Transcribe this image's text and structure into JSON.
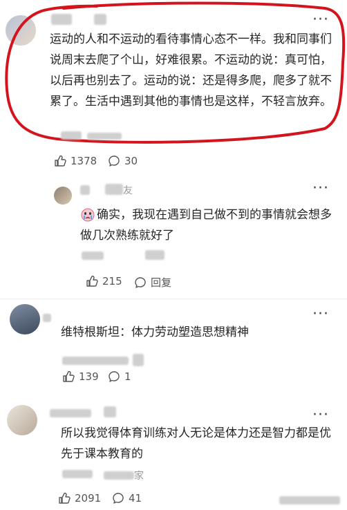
{
  "comments": [
    {
      "text": "运动的人和不运动的看待事情心态不一样。我和同事们说周末去爬了个山，好难很累。不运动的说：真可怕，以后再也别去了。运动的说：还是得多爬，爬多了就不累了。生活中遇到其他的事情也是这样，不轻言放弃。",
      "likes": "1378",
      "replies": "30"
    },
    {
      "username_suffix": "友",
      "text": "确实，我现在遇到自己做不到的事情就会想多做几次熟练就好了",
      "likes": "215",
      "reply_label": "回复"
    },
    {
      "text": "维特根斯坦：体力劳动塑造思想精神",
      "likes": "139",
      "replies": "1"
    },
    {
      "username_suffix": "家",
      "text": "所以我觉得体育训练对人无论是体力还是智力都是优先于课本教育的",
      "likes": "2091",
      "replies": "41"
    }
  ],
  "icons": {
    "like": "thumbs-up-icon",
    "comment": "comment-bubble-icon",
    "more": "more-dots-icon",
    "emoji": "crying-face-emoji-icon"
  },
  "colors": {
    "highlight_circle": "#d4141d",
    "text": "#262626",
    "meta": "#555555"
  }
}
